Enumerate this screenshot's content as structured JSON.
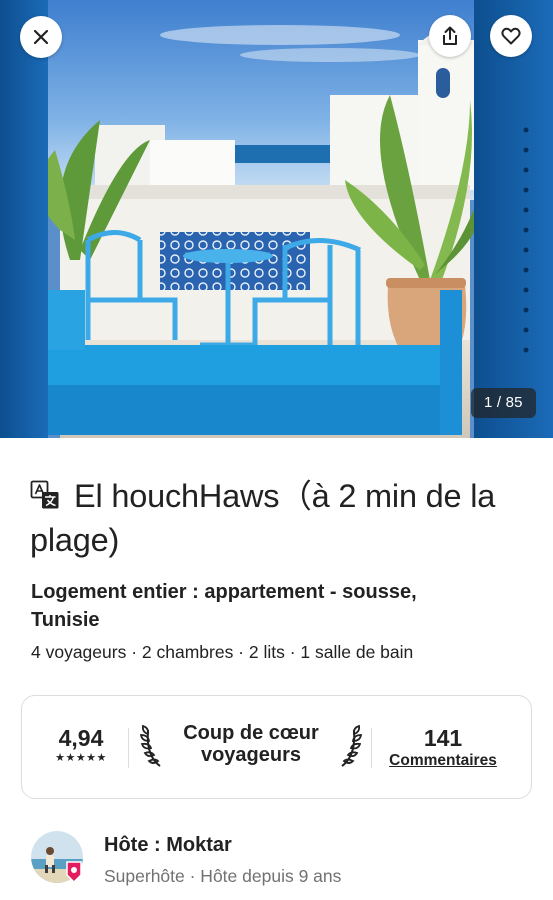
{
  "gallery": {
    "counter": "1 / 85",
    "close_icon": "close-icon",
    "share_icon": "share-icon",
    "favorite_icon": "heart-icon"
  },
  "listing": {
    "title": "El houchHaws（à 2 min de la plage)",
    "translate_icon": "translate-icon",
    "subtitle": "Logement entier : appartement - sousse, Tunisie",
    "details": "4 voyageurs · 2 chambres · 2 lits · 1 salle de bain"
  },
  "highlights": {
    "rating": "4,94",
    "stars": "★★★★★",
    "rating_stars_count": 5,
    "guest_favorite_line1": "Coup de cœur",
    "guest_favorite_line2": "voyageurs",
    "reviews_count": "141",
    "reviews_label": "Commentaires"
  },
  "host": {
    "name": "Hôte : Moktar",
    "meta": "Superhôte · Hôte depuis 9 ans"
  },
  "colors": {
    "text": "#222222",
    "muted": "#717171",
    "border": "#dddddd",
    "brand": "#E31C5F"
  }
}
